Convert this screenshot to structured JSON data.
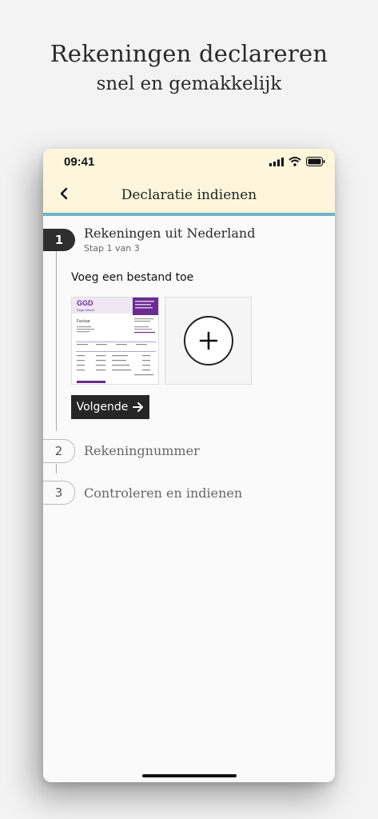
{
  "hero": {
    "line1": "Rekeningen declareren",
    "line2": "snel en gemakkelijk"
  },
  "status_bar": {
    "time": "09:41"
  },
  "nav": {
    "title": "Declaratie indienen",
    "back_icon": "chevron-left-icon"
  },
  "steps": [
    {
      "number": "1",
      "title": "Rekeningen uit Nederland",
      "subtitle": "Stap 1 van 3"
    },
    {
      "number": "2",
      "title": "Rekeningnummer"
    },
    {
      "number": "3",
      "title": "Controleren en indienen"
    }
  ],
  "upload": {
    "label": "Voeg een bestand toe",
    "thumbnail": {
      "logo": "GGD",
      "logo_sub": "Regio Utrecht",
      "heading": "Factuur"
    },
    "add_icon": "plus-icon"
  },
  "next_button": {
    "label": "Volgende",
    "icon": "arrow-right-icon"
  },
  "colors": {
    "accent_line": "#6fb3c9",
    "topbar": "#fdf6dc",
    "purple": "#6a2c91"
  }
}
